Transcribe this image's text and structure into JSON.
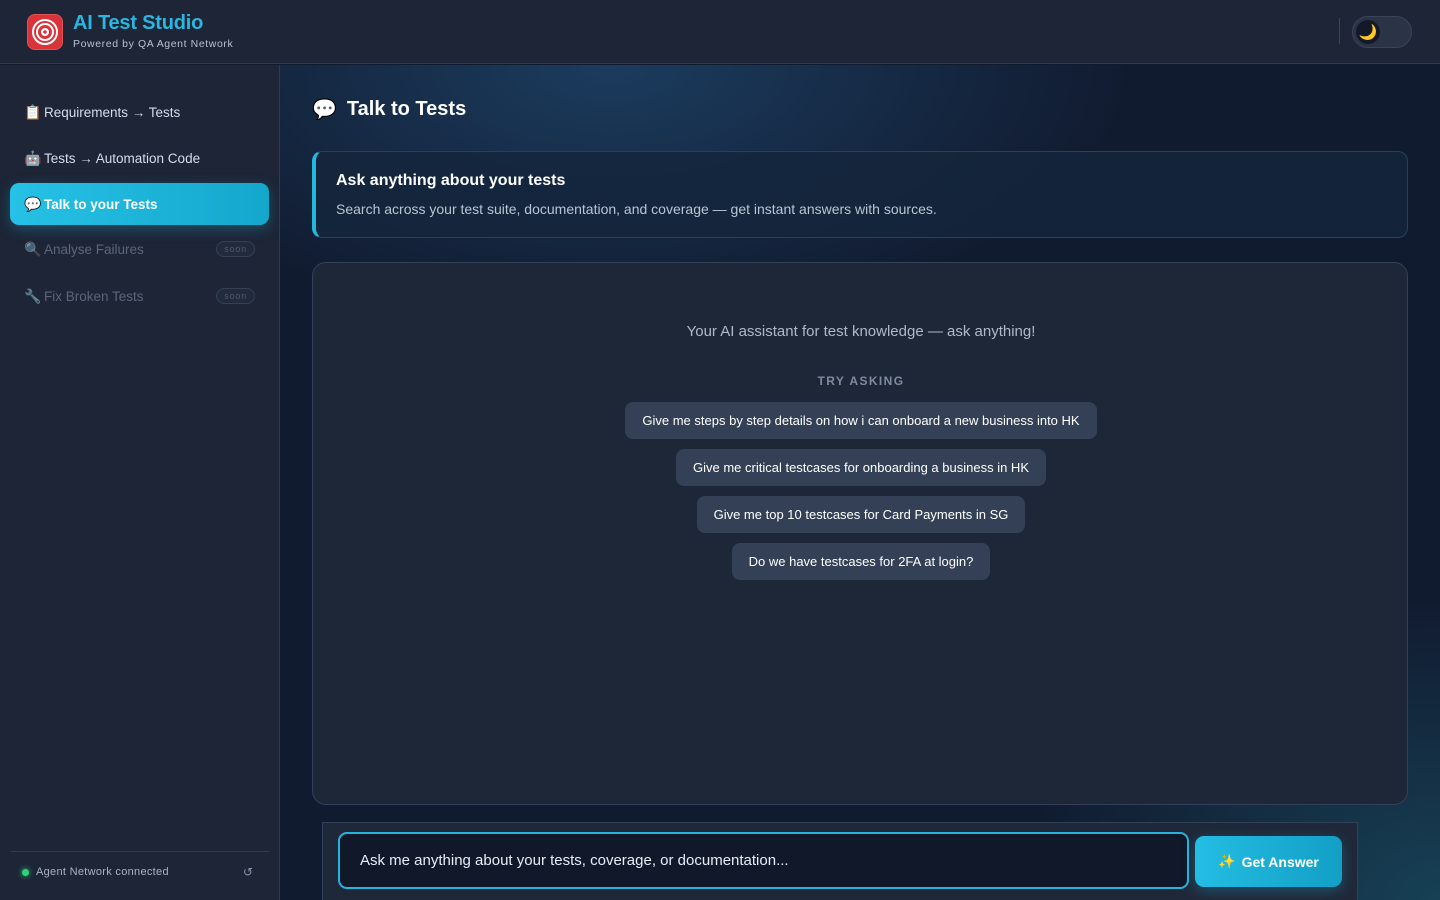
{
  "header": {
    "title": "AI Test Studio",
    "subtitle": "Powered by QA Agent Network",
    "logo_icon": "target-logo-icon",
    "theme_icon": "🌙"
  },
  "sidebar": {
    "items": [
      {
        "icon": "📋",
        "label": "Requirements → Tests",
        "state": "normal"
      },
      {
        "icon": "🤖",
        "label": "Tests → Automation Code",
        "state": "normal"
      },
      {
        "icon": "💬",
        "label": "Talk to your Tests",
        "state": "active"
      },
      {
        "icon": "🔍",
        "label": "Analyse Failures",
        "state": "disabled",
        "badge": "soon"
      },
      {
        "icon": "🔧",
        "label": "Fix Broken Tests",
        "state": "disabled",
        "badge": "soon"
      }
    ],
    "status": {
      "text": "Agent Network connected",
      "color": "#2fd27c",
      "refresh_icon": "↺"
    }
  },
  "main": {
    "title_icon": "💬",
    "title": "Talk to Tests",
    "intro": {
      "title": "Ask anything about your tests",
      "description": "Search across your test suite, documentation, and coverage — get instant answers with sources."
    },
    "chat": {
      "empty_message": "Your AI assistant for test knowledge — ask anything!",
      "try_label": "TRY ASKING",
      "suggestions": [
        "Give me steps by step details on how i can onboard a new business into HK",
        "Give me critical testcases for onboarding a business in HK",
        "Give me top 10 testcases for Card Payments in SG",
        "Do we have testcases for 2FA at login?"
      ]
    },
    "input": {
      "placeholder": "Ask me anything about your tests, coverage, or documentation...",
      "value": ""
    },
    "send_button": {
      "icon": "✨",
      "label": "Get Answer"
    }
  },
  "colors": {
    "accent": "#22b5dd",
    "brand_title": "#2ab6e0",
    "logo_red": "#d8343a",
    "background": "#111b30"
  }
}
